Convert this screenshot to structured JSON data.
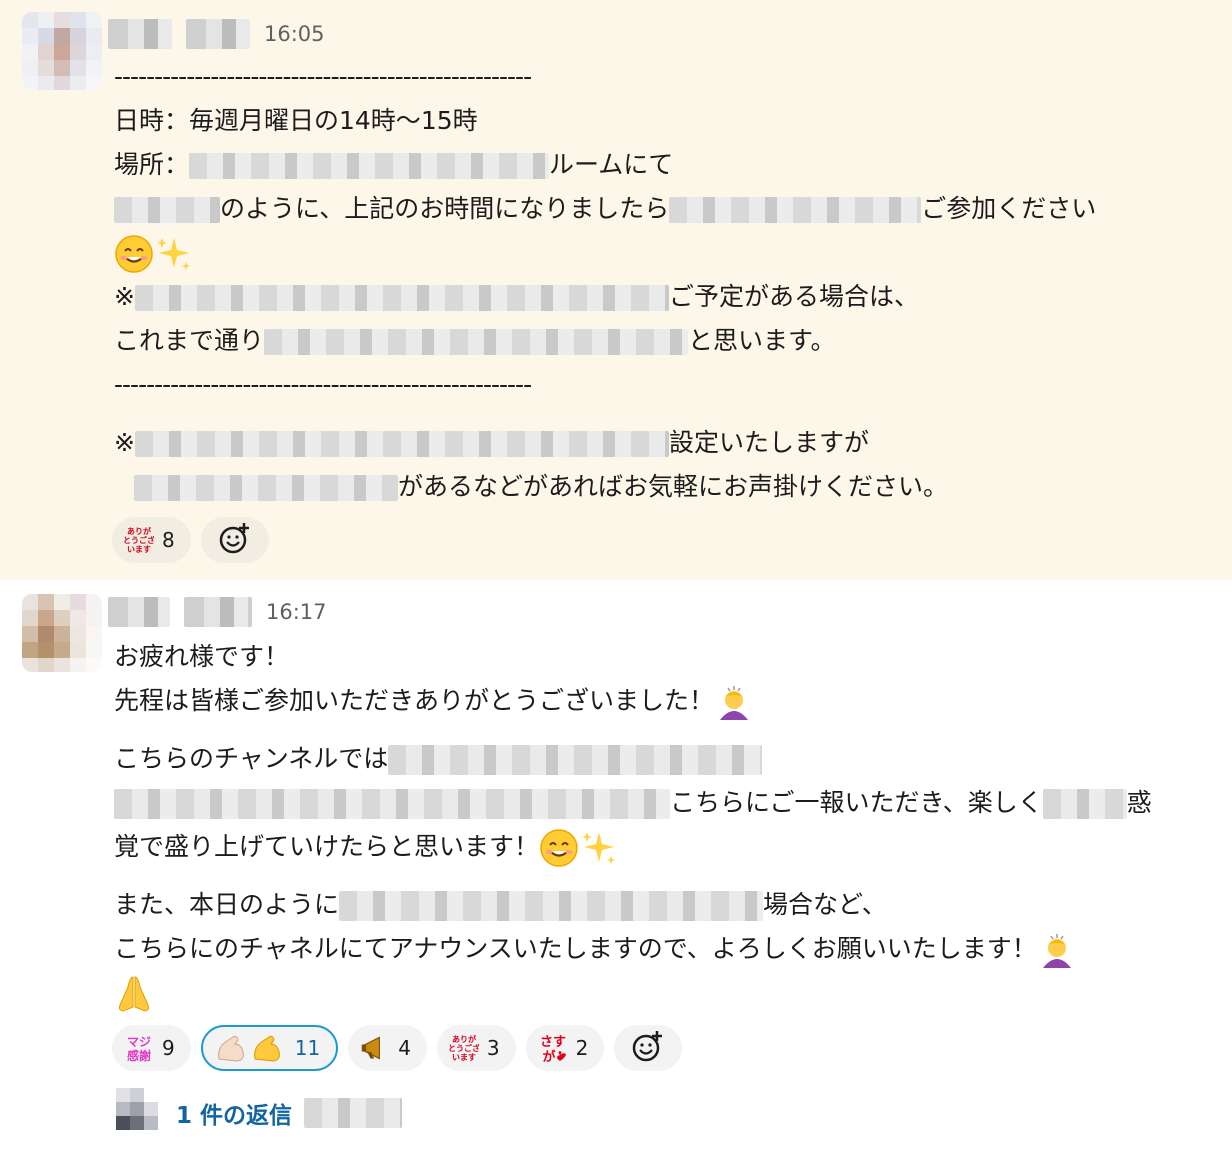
{
  "messages": [
    {
      "time": "16:05",
      "lines": {
        "dash": "----------------------------------------------------",
        "datetime": "日時：毎週月曜日の14時〜15時",
        "place_prefix": "場所：",
        "place_suffix": "ルームにて",
        "join_mid": "のように、上記のお時間になりましたら",
        "join_end": "ご参加ください",
        "note1_prefix": "※",
        "note1_suffix": "ご予定がある場合は、",
        "note2_prefix": "これまで通り",
        "note2_suffix": "と思います。",
        "note3_prefix": "※",
        "note3_suffix": "設定いたしますが",
        "note4_suffix": "があるなどがあればお気軽にお声掛けください。"
      },
      "reactions": [
        {
          "icon": "arigatou-gozaimasu-icon",
          "label": "ありがとうございます",
          "count": "8"
        }
      ]
    },
    {
      "time": "16:17",
      "lines": {
        "l1": "お疲れ様です！",
        "l2": "先程は皆様ご参加いただきありがとうございました！",
        "l3": "こちらのチャンネルでは",
        "l4_suffix": "こちらにご一報いただき、楽しく",
        "l4_end": "惑",
        "l5": "覚で盛り上げていけたらと思います！",
        "l6_prefix": "また、本日のように",
        "l6_suffix": "場合など、",
        "l7": "こちらにのチャネルにてアナウンスいたしますので、よろしくお願いいたします！"
      },
      "reactions": [
        {
          "icon": "maji-kansha-icon",
          "label": "マジ感謝",
          "count": "9"
        },
        {
          "icon": "muscle-icon",
          "label": "",
          "count": "11"
        },
        {
          "icon": "megaphone-icon",
          "label": "",
          "count": "4"
        },
        {
          "icon": "arigatou-gozaimasu-icon",
          "label": "ありがとうございます",
          "count": "3"
        },
        {
          "icon": "sasuga-icon",
          "label": "さすが",
          "count": "2"
        }
      ],
      "thread": {
        "label": "1 件の返信"
      }
    }
  ],
  "colors": {
    "highlight_bg": "#fdf7ea",
    "link": "#1264a3",
    "active_reaction_border": "#1d9bd1"
  }
}
